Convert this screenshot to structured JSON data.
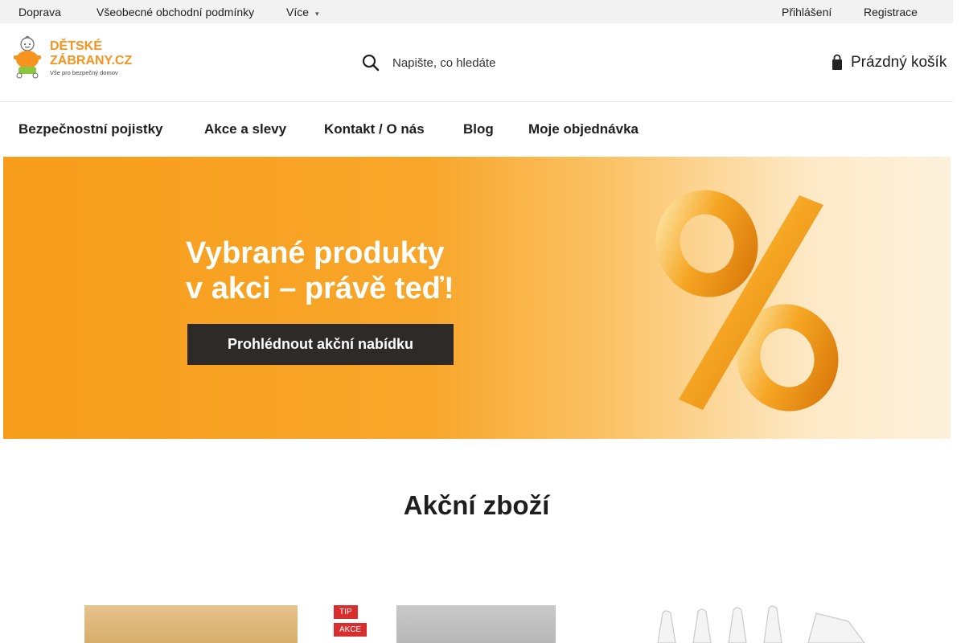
{
  "topbar": {
    "links": [
      "Doprava",
      "Všeobecné obchodní podmínky",
      "Více"
    ],
    "account": [
      "Přihlášení",
      "Registrace"
    ]
  },
  "header": {
    "logo_line1": "DĚTSKÉ",
    "logo_line2": "ZÁBRANY.CZ",
    "logo_tagline": "Vše pro bezpečný domov",
    "search_placeholder": "Napište, co hledáte",
    "cart_label": "Prázdný košík"
  },
  "nav": {
    "items": [
      "Bezpečnostní pojistky",
      "Akce a slevy",
      "Kontakt / O nás",
      "Blog",
      "Moje objednávka"
    ]
  },
  "banner": {
    "headline": "Vybrané produkty\nv akci – právě teď!",
    "cta": "Prohlédnout akční nabídku"
  },
  "section": {
    "title": "Akční zboží"
  },
  "products": {
    "badges": [
      "TIP",
      "AKCE"
    ]
  },
  "colors": {
    "banner_orange": "#f79d1b",
    "badge_tip": "#d92e2e",
    "badge_akce": "#d92e2e",
    "button_dark": "#2d2a28"
  },
  "icons": {
    "search": "magnifier-icon",
    "cart": "shopping-bag-icon",
    "more": "chevron-down-icon"
  }
}
